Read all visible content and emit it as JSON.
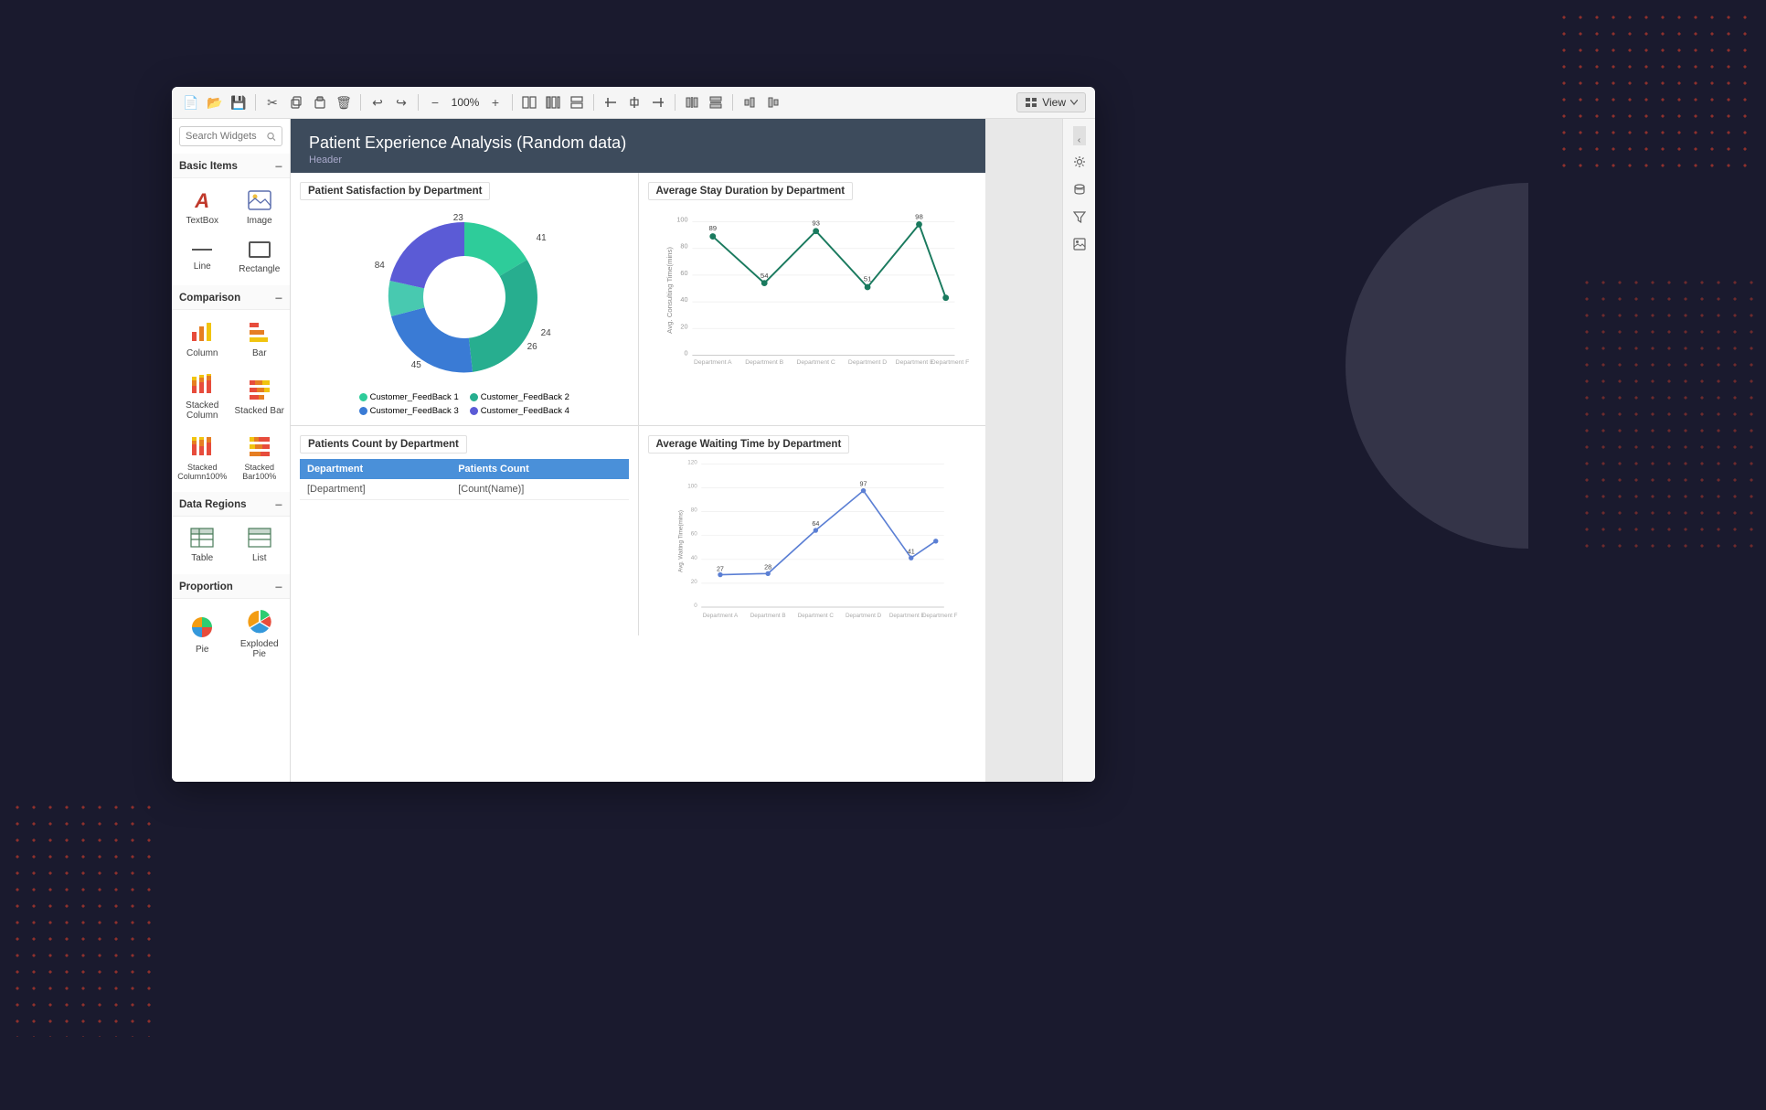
{
  "app": {
    "title": "Patient Experience Analysis (Random data)",
    "subtitle": "Header"
  },
  "toolbar": {
    "zoom": "100%",
    "view_label": "View",
    "icons": [
      "new-doc",
      "open",
      "save",
      "cut",
      "copy",
      "paste",
      "delete",
      "undo",
      "redo",
      "zoom-out",
      "zoom-in",
      "layout1",
      "layout2",
      "layout3",
      "toolbar1",
      "toolbar2",
      "toolbar3",
      "align1",
      "align2",
      "align3",
      "align4",
      "align5"
    ]
  },
  "sidebar": {
    "search_placeholder": "Search Widgets",
    "sections": [
      {
        "name": "Basic Items",
        "items": [
          {
            "id": "textbox",
            "label": "TextBox"
          },
          {
            "id": "image",
            "label": "Image"
          },
          {
            "id": "line",
            "label": "Line"
          },
          {
            "id": "rectangle",
            "label": "Rectangle"
          }
        ]
      },
      {
        "name": "Comparison",
        "items": [
          {
            "id": "column",
            "label": "Column"
          },
          {
            "id": "bar",
            "label": "Bar"
          },
          {
            "id": "stacked-column",
            "label": "Stacked Column"
          },
          {
            "id": "stacked-bar",
            "label": "Stacked Bar"
          },
          {
            "id": "stacked-column100",
            "label": "Stacked Column100%"
          },
          {
            "id": "stacked-bar100",
            "label": "Stacked Bar100%"
          }
        ]
      },
      {
        "name": "Data Regions",
        "items": [
          {
            "id": "table",
            "label": "Table"
          },
          {
            "id": "list",
            "label": "List"
          }
        ]
      },
      {
        "name": "Proportion",
        "items": [
          {
            "id": "pie",
            "label": "Pie"
          },
          {
            "id": "exploded-pie",
            "label": "Exploded Pie"
          }
        ]
      }
    ]
  },
  "charts": {
    "patient_satisfaction": {
      "title": "Patient Satisfaction by Department",
      "donut": {
        "segments": [
          {
            "label": "23",
            "color": "#2ecc9a",
            "value": 23,
            "startAngle": 0
          },
          {
            "label": "41",
            "color": "#27ae8f",
            "value": 41,
            "startAngle": 82.8
          },
          {
            "label": "24",
            "color": "#3a7bd5",
            "value": 24,
            "startAngle": 230.4
          },
          {
            "label": "26",
            "color": "#5b5bd6",
            "value": 26,
            "startAngle": 316.8
          },
          {
            "label": "45",
            "color": "#1abc9c",
            "value": 45,
            "startAngle": 410
          },
          {
            "label": "84",
            "color": "#48c9b0",
            "value": 84,
            "startAngle": 572
          }
        ]
      },
      "legend": [
        {
          "label": "Customer_FeedBack 1",
          "color": "#2ecc9a"
        },
        {
          "label": "Customer_FeedBack 2",
          "color": "#27ae8f"
        },
        {
          "label": "Customer_FeedBack 3",
          "color": "#3a7bd5"
        },
        {
          "label": "Customer_FeedBack 4",
          "color": "#5b5bd6"
        }
      ]
    },
    "avg_stay": {
      "title": "Average Stay Duration by Department",
      "y_label": "Avg. Consulting Time(mins)",
      "x_labels": [
        "Department A",
        "Department B",
        "Department C",
        "Department D",
        "Department E",
        "Department F"
      ],
      "y_ticks": [
        0,
        20,
        40,
        60,
        80,
        100
      ],
      "data_points": [
        {
          "x": 0,
          "y": 89,
          "label": "89"
        },
        {
          "x": 1,
          "y": 54,
          "label": "54"
        },
        {
          "x": 2,
          "y": 93,
          "label": "93"
        },
        {
          "x": 3,
          "y": 51,
          "label": "51"
        },
        {
          "x": 4,
          "y": 98,
          "label": "98"
        },
        {
          "x": 5,
          "y": 43,
          "label": "~43"
        }
      ]
    },
    "patients_count": {
      "title": "Patients Count by Department",
      "table": {
        "headers": [
          "Department",
          "Patients Count"
        ],
        "rows": [
          {
            "col1": "[Department]",
            "col2": "[Count(Name)]"
          }
        ]
      }
    },
    "avg_waiting": {
      "title": "Average Waiting Time by Department",
      "y_label": "Avg. Waiting Time(mins)",
      "x_labels": [
        "Department A",
        "Department B",
        "Department C",
        "Department D",
        "Department E",
        "Department F"
      ],
      "y_ticks": [
        0,
        20,
        40,
        60,
        80,
        100,
        120
      ],
      "data_points": [
        {
          "x": 0,
          "y": 27,
          "label": "27"
        },
        {
          "x": 1,
          "y": 28,
          "label": "28"
        },
        {
          "x": 2,
          "y": 64,
          "label": "64"
        },
        {
          "x": 3,
          "y": 97,
          "label": "97"
        },
        {
          "x": 4,
          "y": 41,
          "label": "41"
        },
        {
          "x": 5,
          "y": 55,
          "label": "~55"
        }
      ]
    }
  }
}
